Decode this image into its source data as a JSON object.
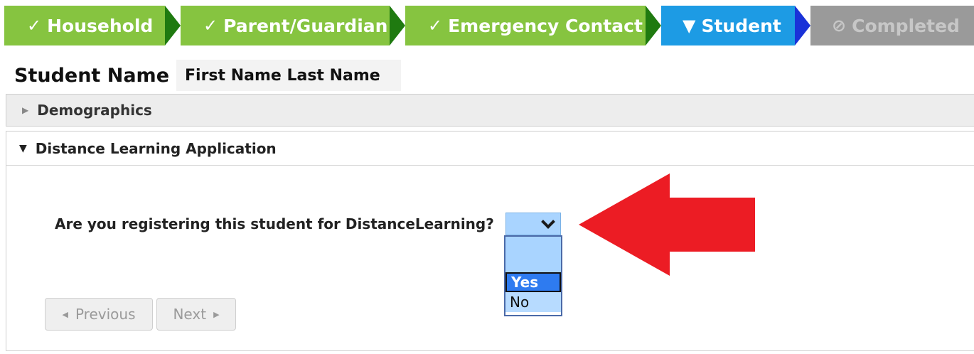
{
  "steps": [
    {
      "label": "Household",
      "glyph": "✓",
      "state": "done"
    },
    {
      "label": "Parent/Guardian",
      "glyph": "✓",
      "state": "done"
    },
    {
      "label": "Emergency Contact",
      "glyph": "✓",
      "state": "done"
    },
    {
      "label": "Student",
      "glyph": "▼",
      "state": "current"
    },
    {
      "label": "Completed",
      "glyph": "⊘",
      "state": "disabled"
    }
  ],
  "student": {
    "label": "Student Name",
    "value": "First Name Last Name"
  },
  "sections": {
    "demographics": {
      "title": "Demographics",
      "expanded": false
    },
    "distance": {
      "title": "Distance Learning Application",
      "expanded": true
    }
  },
  "question": {
    "text": "Are you registering this student for DistanceLearning?",
    "selected": "",
    "options": [
      "",
      "Yes",
      "No"
    ],
    "highlighted": "Yes"
  },
  "nav": {
    "previous": "Previous",
    "next": "Next"
  },
  "colors": {
    "step_done": "#86c440",
    "step_current": "#1d9be4",
    "step_disabled": "#9a9a9a",
    "callout_arrow": "#ec1c24"
  }
}
